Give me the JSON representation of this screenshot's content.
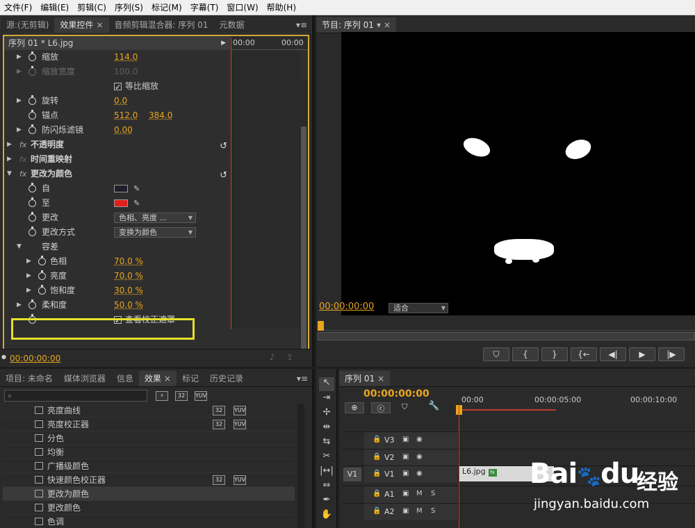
{
  "menu": [
    "文件(F)",
    "编辑(E)",
    "剪辑(C)",
    "序列(S)",
    "标记(M)",
    "字幕(T)",
    "窗口(W)",
    "帮助(H)"
  ],
  "effect_controls": {
    "tabs": [
      "源:(无剪辑)",
      "效果控件",
      "音频剪辑混合器: 序列 01",
      "元数据"
    ],
    "header": "序列 01 * L6.jpg",
    "ruler": [
      "00:00",
      "00:00"
    ],
    "rows": {
      "scale": {
        "label": "缩放",
        "value": "114.0"
      },
      "scale_width": {
        "label": "缩放宽度",
        "value": "100.0"
      },
      "uniform": {
        "label": "等比缩放"
      },
      "rotation": {
        "label": "旋转",
        "value": "0.0"
      },
      "anchor": {
        "label": "锚点",
        "x": "512.0",
        "y": "384.0"
      },
      "antiflicker": {
        "label": "防闪烁滤镜",
        "value": "0.00"
      },
      "opacity": {
        "label": "不透明度"
      },
      "time_remap": {
        "label": "时间重映射"
      },
      "change_to_color": {
        "label": "更改为颜色"
      },
      "from": {
        "label": "自",
        "color": "#211e2c"
      },
      "to": {
        "label": "至",
        "color": "#e0201a"
      },
      "change": {
        "label": "更改",
        "value": "色相、亮度 ..."
      },
      "change_by": {
        "label": "更改方式",
        "value": "变换为颜色"
      },
      "tolerance": {
        "label": "容差"
      },
      "hue": {
        "label": "色相",
        "value": "70.0 %"
      },
      "lightness": {
        "label": "亮度",
        "value": "70.0 %"
      },
      "saturation": {
        "label": "饱和度",
        "value": "30.0 %"
      },
      "softness": {
        "label": "柔和度",
        "value": "50.0 %"
      },
      "view_mask": {
        "label": "查看校正遮罩"
      }
    },
    "footer_tc": "00:00:00:00"
  },
  "program": {
    "tab": "节目: 序列 01",
    "timecode": "00:00:00:00",
    "fit": "适合"
  },
  "project": {
    "tabs": [
      "项目: 未命名",
      "媒体浏览器",
      "信息",
      "效果",
      "标记",
      "历史记录"
    ],
    "badges": [
      "32",
      "32",
      "YUV"
    ],
    "effects": [
      {
        "name": "亮度曲线",
        "b32": "32",
        "yuv": "YUV"
      },
      {
        "name": "亮度校正器",
        "b32": "32",
        "yuv": "YUV"
      },
      {
        "name": "分色"
      },
      {
        "name": "均衡"
      },
      {
        "name": "广播级颜色"
      },
      {
        "name": "快速颜色校正器",
        "b32": "32",
        "yuv": "YUV"
      },
      {
        "name": "更改为颜色"
      },
      {
        "name": "更改颜色"
      },
      {
        "name": "色调"
      }
    ]
  },
  "sequence": {
    "tab": "序列 01",
    "timecode": "00:00:00:00",
    "ruler": [
      "00:00",
      "00:00:05:00",
      "00:00:10:00"
    ],
    "tracks": [
      "V3",
      "V2",
      "V1",
      "A1",
      "A2"
    ],
    "source_v1": "V1",
    "clip": "L6.jpg",
    "clip_fx": "fx",
    "m": "M",
    "s": "S"
  },
  "watermark": {
    "brand": "Bai",
    "brand_suffix": "du",
    "jy": "经验",
    "url": "jingyan.baidu.com"
  }
}
